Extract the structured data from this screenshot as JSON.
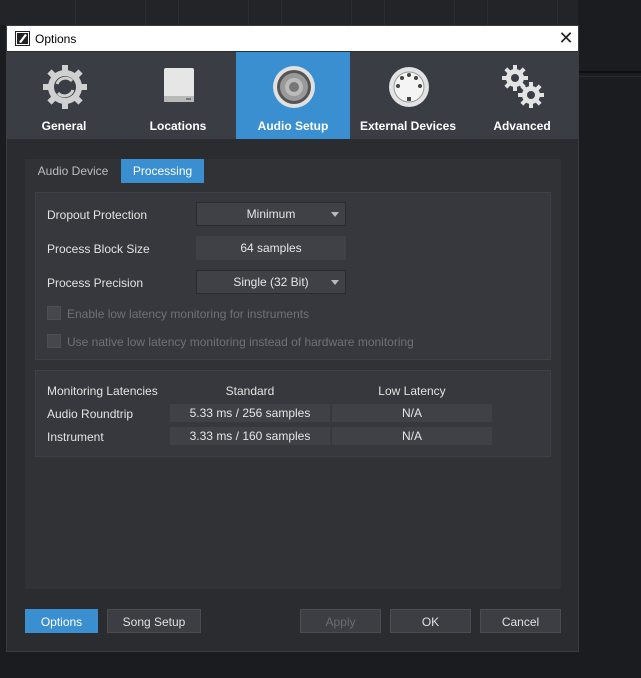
{
  "dialog": {
    "title": "Options"
  },
  "tabs": [
    {
      "label": "General",
      "icon": "gear-cycle-icon",
      "active": false
    },
    {
      "label": "Locations",
      "icon": "drive-icon",
      "active": false
    },
    {
      "label": "Audio Setup",
      "icon": "speaker-icon",
      "active": true
    },
    {
      "label": "External Devices",
      "icon": "midi-connector-icon",
      "active": false
    },
    {
      "label": "Advanced",
      "icon": "gears-icon",
      "active": false
    }
  ],
  "subtabs": {
    "audio_device": "Audio Device",
    "processing": "Processing"
  },
  "processing": {
    "dropout_label": "Dropout Protection",
    "dropout_value": "Minimum",
    "block_size_label": "Process Block Size",
    "block_size_value": "64 samples",
    "precision_label": "Process Precision",
    "precision_value": "Single (32 Bit)",
    "low_latency_instruments": "Enable low latency monitoring for instruments",
    "native_low_latency": "Use native low latency monitoring instead of hardware monitoring"
  },
  "latency": {
    "header": "Monitoring Latencies",
    "col_standard": "Standard",
    "col_low": "Low Latency",
    "rows": [
      {
        "label": "Audio Roundtrip",
        "standard": "5.33 ms / 256 samples",
        "low": "N/A"
      },
      {
        "label": "Instrument",
        "standard": "3.33 ms / 160 samples",
        "low": "N/A"
      }
    ]
  },
  "footer": {
    "options": "Options",
    "song_setup": "Song Setup",
    "apply": "Apply",
    "ok": "OK",
    "cancel": "Cancel"
  },
  "colors": {
    "accent": "#3a8fd0",
    "panel": "#303236",
    "tab_bar": "#3a3d44"
  }
}
